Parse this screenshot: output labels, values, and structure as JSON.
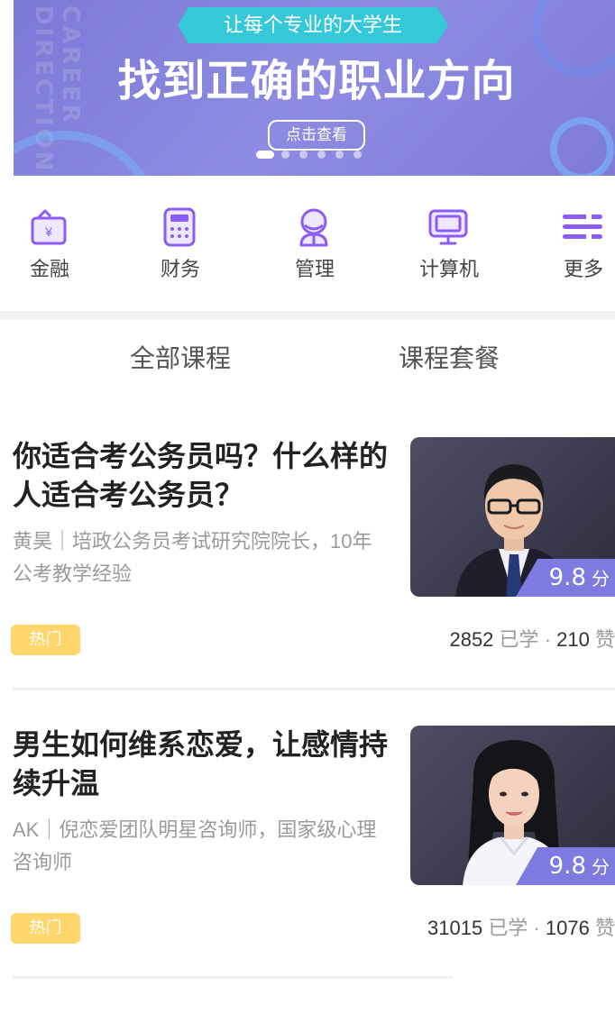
{
  "banner": {
    "ribbon_text": "让每个专业的大学生",
    "headline": "找到正确的职业方向",
    "cta_label": "点击查看",
    "deco_text": "CAREER DIRECTION",
    "slide_count": 6,
    "active_slide": 1,
    "colors": {
      "background": "#7f7dd9",
      "ribbon": "#35c8d8"
    }
  },
  "categories": [
    {
      "label": "金融",
      "icon": "finance-wallet-icon",
      "color": "#8b5cf6"
    },
    {
      "label": "财务",
      "icon": "calculator-icon",
      "color": "#8b5cf6"
    },
    {
      "label": "管理",
      "icon": "manager-person-icon",
      "color": "#8b5cf6"
    },
    {
      "label": "计算机",
      "icon": "computer-monitor-icon",
      "color": "#8b5cf6"
    },
    {
      "label": "更多",
      "icon": "more-menu-icon",
      "color": "#8b5cf6"
    }
  ],
  "tabs": [
    {
      "label": "全部课程"
    },
    {
      "label": "课程套餐"
    }
  ],
  "courses": [
    {
      "title": "你适合考公务员吗？什么样的人适合考公务员？",
      "instructor_line": "黄昊｜培政公务员考试研究院院长，10年公考教学经验",
      "badge": "热门",
      "score": "9.8",
      "score_unit": "分",
      "learned_count": "2852",
      "learned_label": "已学",
      "likes_count": "210",
      "likes_label": "赞",
      "thumbnail": "male-instructor-portrait"
    },
    {
      "title": "男生如何维系恋爱，让感情持续升温",
      "instructor_line": "AK｜倪恋爱团队明星咨询师，国家级心理咨询师",
      "badge": "热门",
      "score": "9.8",
      "score_unit": "分",
      "learned_count": "31015",
      "learned_label": "已学",
      "likes_count": "1076",
      "likes_label": "赞",
      "thumbnail": "female-instructor-portrait"
    }
  ],
  "colors": {
    "accent": "#7d7be0",
    "badge": "#ffd66b",
    "muted_text": "#9a9a9a"
  }
}
